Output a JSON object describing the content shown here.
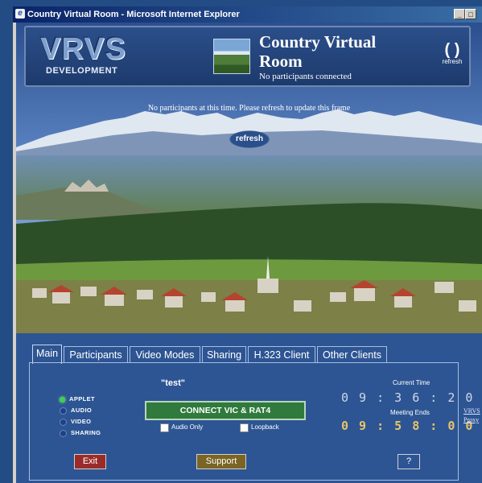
{
  "window": {
    "title": "Country Virtual Room - Microsoft Internet Explorer",
    "icon": "ie-icon",
    "minimize": "_",
    "maximize": "□"
  },
  "header": {
    "logo_text": "VRVS",
    "logo_sub": "DEVELOPMENT",
    "room_title": "Country Virtual Room",
    "room_status": "No participants connected",
    "refresh_label": "refresh"
  },
  "scene": {
    "notice": "No participants at this time. Please refresh to update this frame",
    "refresh_label": "refresh"
  },
  "tabs": [
    {
      "label": "Main",
      "active": true
    },
    {
      "label": "Participants"
    },
    {
      "label": "Video Modes"
    },
    {
      "label": "Sharing"
    },
    {
      "label": "H.323 Client"
    },
    {
      "label": "Other Clients"
    }
  ],
  "main": {
    "session_name": "\"test\"",
    "status_items": [
      {
        "label": "APPLET",
        "color": "#3fd04a"
      },
      {
        "label": "AUDIO",
        "color": "#1f3f8a"
      },
      {
        "label": "VIDEO",
        "color": "#1f3f8a"
      },
      {
        "label": "SHARING",
        "color": "#1f3f8a"
      }
    ],
    "connect_label": "CONNECT VIC & RAT4",
    "audio_only_label": "Audio Only",
    "loopback_label": "Loopback",
    "current_time_label": "Current Time",
    "current_time": "09:36:20",
    "meeting_ends_label": "Meeting Ends",
    "meeting_ends": "09:58:00",
    "exit_label": "Exit",
    "support_label": "Support",
    "help_label": "?",
    "side_link_1": "VRVS",
    "side_link_2": "Proxy"
  }
}
